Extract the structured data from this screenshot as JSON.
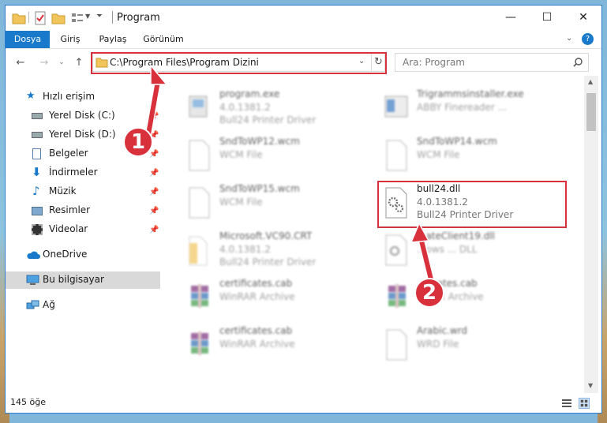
{
  "window": {
    "title": "Program",
    "controls": {
      "minimize": "—",
      "maximize": "☐",
      "close": "✕"
    }
  },
  "ribbon": {
    "tabs": [
      {
        "label": "Dosya",
        "active": true
      },
      {
        "label": "Giriş",
        "active": false
      },
      {
        "label": "Paylaş",
        "active": false
      },
      {
        "label": "Görünüm",
        "active": false
      }
    ]
  },
  "address": {
    "path": "C:\\Program Files\\Program Dizini",
    "search_placeholder": "Ara: Program"
  },
  "sidebar": {
    "items": [
      {
        "label": "Hızlı erişim",
        "icon": "star-icon",
        "pinned": false
      },
      {
        "label": "Yerel Disk (C:)",
        "icon": "drive-c-icon",
        "pinned": true
      },
      {
        "label": "Yerel Disk (D:)",
        "icon": "drive-d-icon",
        "pinned": true
      },
      {
        "label": "Belgeler",
        "icon": "documents-icon",
        "pinned": true
      },
      {
        "label": "İndirmeler",
        "icon": "downloads-icon",
        "pinned": true
      },
      {
        "label": "Müzik",
        "icon": "music-icon",
        "pinned": true
      },
      {
        "label": "Resimler",
        "icon": "pictures-icon",
        "pinned": true
      },
      {
        "label": "Videolar",
        "icon": "videos-icon",
        "pinned": true
      },
      {
        "label": "OneDrive",
        "icon": "onedrive-icon",
        "pinned": false
      },
      {
        "label": "Bu bilgisayar",
        "icon": "this-pc-icon",
        "pinned": false,
        "selected": true
      },
      {
        "label": "Ağ",
        "icon": "network-icon",
        "pinned": false
      }
    ]
  },
  "files": [
    {
      "name": "program.exe",
      "line2": "4.0.1381.2",
      "line3": "Bull24 Printer Driver",
      "icon": "exe-icon",
      "blurred": true
    },
    {
      "name": "Trigrammsinstaller.exe",
      "line2": "ABBY Finereader ...",
      "line3": "",
      "icon": "exe-icon",
      "blurred": true
    },
    {
      "name": "SndToWP12.wcm",
      "line2": "WCM File",
      "line3": "",
      "icon": "file-icon",
      "blurred": true
    },
    {
      "name": "SndToWP14.wcm",
      "line2": "WCM File",
      "line3": "",
      "icon": "file-icon",
      "blurred": true
    },
    {
      "name": "SndToWP15.wcm",
      "line2": "WCM File",
      "line3": "",
      "icon": "file-icon",
      "blurred": true
    },
    {
      "name": "bull24.dll",
      "line2": "4.0.1381.2",
      "line3": "Bull24 Printer Driver",
      "icon": "dll-gear-icon",
      "blurred": false
    },
    {
      "name": "Microsoft.VC90.CRT",
      "line2": "4.0.1381.2",
      "line3": "Bull24 Printer Driver",
      "icon": "folder-icon",
      "blurred": true
    },
    {
      "name": "...ateClient19.dll",
      "line2": "...ows ... DLL",
      "line3": "",
      "icon": "dll-gear-icon",
      "blurred": true
    },
    {
      "name": "certificates.cab",
      "line2": "WinRAR Archive",
      "line3": "",
      "icon": "winrar-icon",
      "blurred": true
    },
    {
      "name": "...ficates.cab",
      "line2": "...RAR Archive",
      "line3": "",
      "icon": "winrar-icon",
      "blurred": true
    },
    {
      "name": "certificates.cab",
      "line2": "WinRAR Archive",
      "line3": "",
      "icon": "winrar-icon",
      "blurred": true
    },
    {
      "name": "Arabic.wrd",
      "line2": "WRD File",
      "line3": "",
      "icon": "file-icon",
      "blurred": true
    }
  ],
  "status": {
    "count": "145 öğe"
  },
  "callouts": [
    "1",
    "2"
  ],
  "colors": {
    "accent": "#1979ca",
    "highlight": "#d8313c",
    "folder": "#f2c55c"
  }
}
